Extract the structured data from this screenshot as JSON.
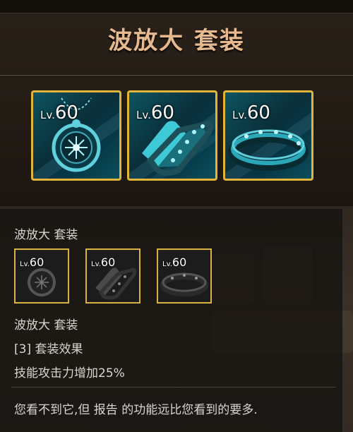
{
  "header": {
    "title": "波放大 套装"
  },
  "items": [
    {
      "icon": "pendant-icon",
      "level_prefix": "Lv.",
      "level": "60"
    },
    {
      "icon": "bracelet-icon",
      "level_prefix": "Lv.",
      "level": "60"
    },
    {
      "icon": "ring-icon",
      "level_prefix": "Lv.",
      "level": "60"
    }
  ],
  "tooltip": {
    "set_name": "波放大 套装",
    "set_name_repeat": "波放大 套装",
    "effect_header": "[3] 套装效果",
    "effect_description": "技能攻击力增加25%",
    "footer_note": "您看不到它,但 报告 的功能远比您看到的要多."
  },
  "colors": {
    "title": "#e7b98f",
    "item_border": "#e0b53a",
    "item_glow": "#3fd6e6",
    "tooltip_text": "#d8d6d0"
  }
}
